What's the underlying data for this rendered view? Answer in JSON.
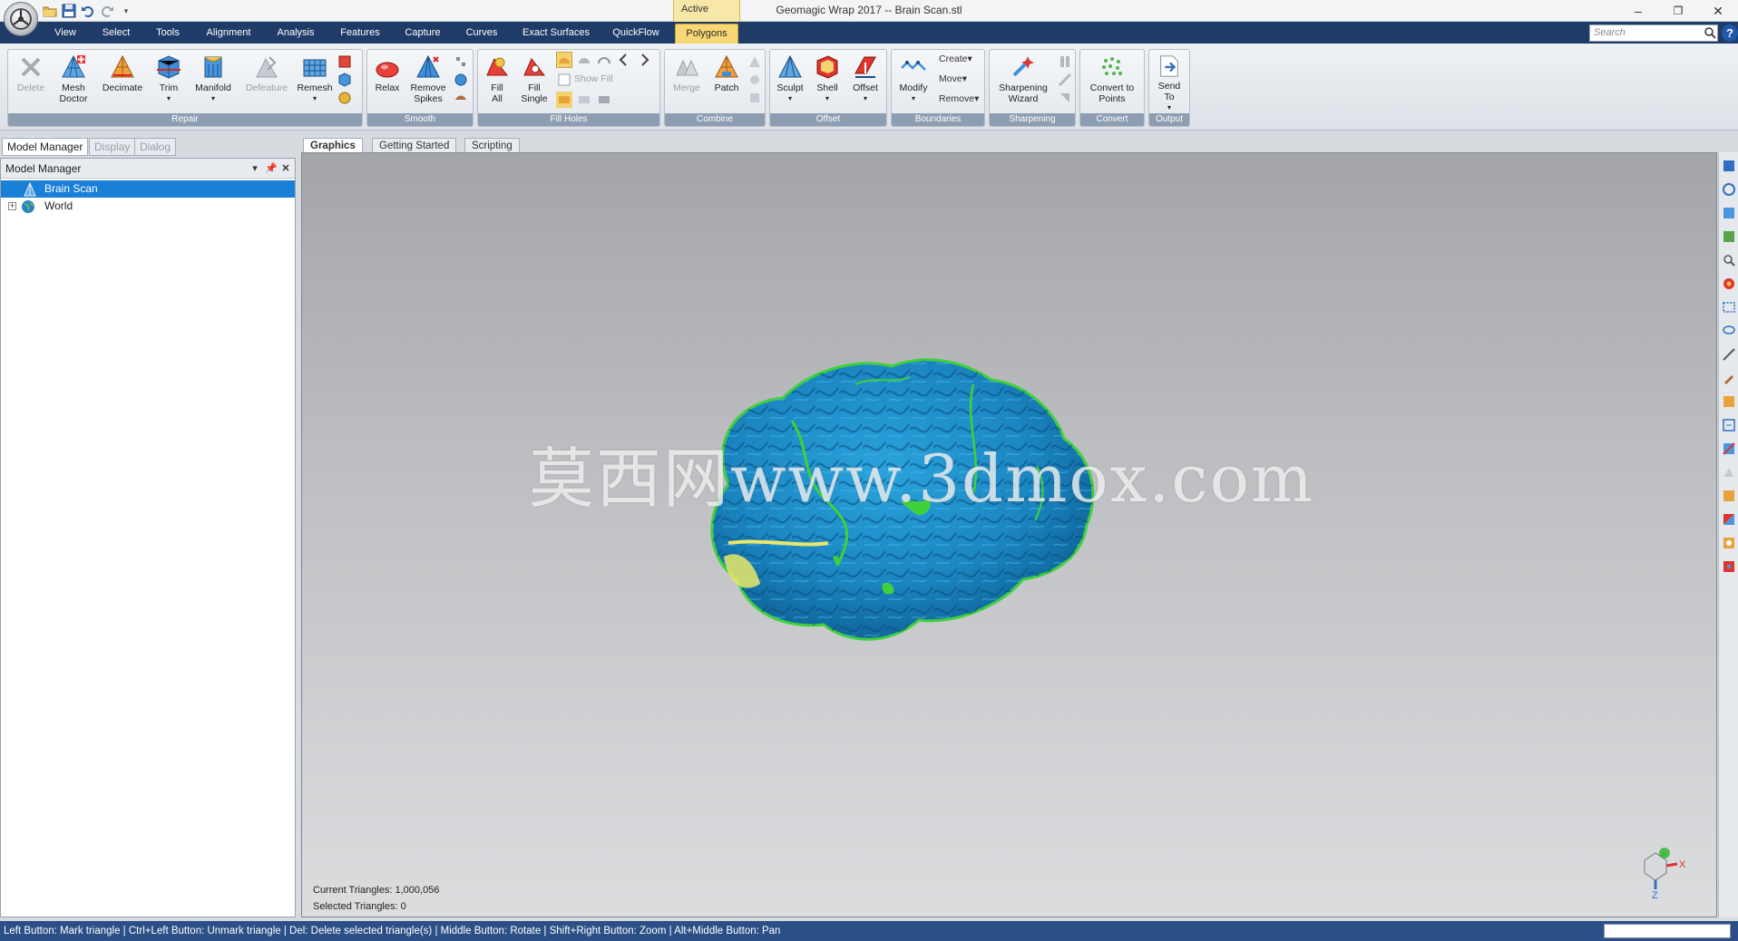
{
  "app": {
    "title": "Geomagic Wrap 2017 -- Brain Scan.stl",
    "context_tab": "Active",
    "window_controls": [
      "–",
      "❐",
      "✕"
    ]
  },
  "menu": {
    "tabs": [
      "View",
      "Select",
      "Tools",
      "Alignment",
      "Analysis",
      "Features",
      "Capture",
      "Curves",
      "Exact Surfaces",
      "QuickFlow",
      "Polygons"
    ],
    "active_tab": "Polygons"
  },
  "search": {
    "placeholder": "Search"
  },
  "ribbon": {
    "repair": {
      "label": "Repair",
      "delete": "Delete",
      "mesh_doctor": "Mesh\nDoctor",
      "decimate": "Decimate",
      "trim": "Trim",
      "manifold": "Manifold",
      "defeature": "Defeature",
      "remesh": "Remesh"
    },
    "smooth": {
      "label": "Smooth",
      "relax": "Relax",
      "remove_spikes": "Remove\nSpikes"
    },
    "fill_holes": {
      "label": "Fill Holes",
      "fill_all": "Fill\nAll",
      "fill_single": "Fill\nSingle",
      "show_fill": "Show Fill"
    },
    "combine": {
      "label": "Combine",
      "merge": "Merge",
      "patch": "Patch"
    },
    "offset": {
      "label": "Offset",
      "sculpt": "Sculpt",
      "shell": "Shell",
      "offset": "Offset"
    },
    "boundaries": {
      "label": "Boundaries",
      "modify": "Modify",
      "create": "Create",
      "move": "Move",
      "remove": "Remove"
    },
    "sharpening": {
      "label": "Sharpening",
      "wizard": "Sharpening\nWizard"
    },
    "convert": {
      "label": "Convert",
      "convert_to_points": "Convert to\nPoints"
    },
    "output": {
      "label": "Output",
      "send_to": "Send\nTo"
    }
  },
  "panel_tabs": [
    "Model Manager",
    "Display",
    "Dialog"
  ],
  "model_manager": {
    "title": "Model Manager",
    "items": [
      {
        "label": "Brain Scan",
        "selected": true
      },
      {
        "label": "World",
        "selected": false
      }
    ]
  },
  "view_tabs": [
    "Graphics",
    "Getting Started",
    "Scripting"
  ],
  "viewport": {
    "watermark": "莫西网www.3dmox.com",
    "current_triangles": "Current Triangles: 1,000,056",
    "selected_triangles": "Selected Triangles: 0",
    "axis_x": "X",
    "axis_z": "Z"
  },
  "colors": {
    "menu_bar": "#1f3b68",
    "active_tab": "#f8d875",
    "selection": "#1a7fd6",
    "model_blue": "#1d8fc7",
    "model_highlight_green": "#3fd13a",
    "model_highlight_yellow": "#e8e86a",
    "status_bar": "#2b4f86"
  },
  "status": {
    "text": "Left Button: Mark triangle | Ctrl+Left Button: Unmark triangle | Del: Delete selected triangle(s) | Middle Button: Rotate | Shift+Right Button: Zoom | Alt+Middle Button: Pan"
  }
}
